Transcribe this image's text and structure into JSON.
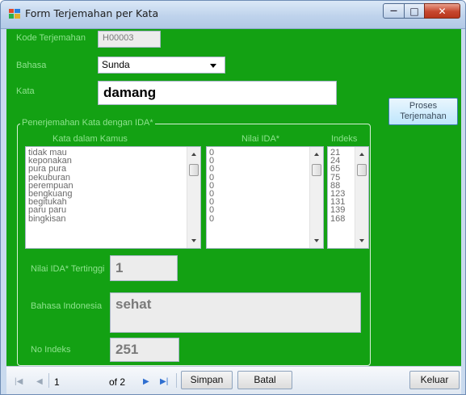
{
  "window": {
    "title": "Form Terjemahan per Kata",
    "minimize_glyph": "—",
    "maximize_glyph": "□",
    "close_glyph": "✕"
  },
  "colors": {
    "form_background": "#13a113",
    "label_text": "#8ee38e"
  },
  "form": {
    "kode_label": "Kode Terjemahan",
    "kode_value": "H00003",
    "bahasa_label": "Bahasa",
    "bahasa_value": "Sunda",
    "kata_label": "Kata",
    "kata_value": "damang",
    "proses_button_line1": "Proses",
    "proses_button_line2": "Terjemahan"
  },
  "group": {
    "title": "Penerjemahan Kata dengan IDA*",
    "col_kata_header": "Kata dalam Kamus",
    "col_nilai_header": "Nilai IDA*",
    "col_indeks_header": "Indeks",
    "kata_items": [
      "tidak mau",
      "keponakan",
      "pura pura",
      "pekuburan",
      "perempuan",
      "bengkuang",
      "begitukah",
      "paru paru",
      "bingkisan"
    ],
    "nilai_items": [
      "0",
      "0",
      "0",
      "0",
      "0",
      "0",
      "0",
      "0",
      "0"
    ],
    "indeks_items": [
      "21",
      "24",
      "65",
      "75",
      "88",
      "123",
      "131",
      "139",
      "168"
    ],
    "nilai_tertinggi_label": "Nilai IDA* Tertinggi",
    "nilai_tertinggi_value": "1",
    "bahasa_indonesia_label": "Bahasa Indonesia",
    "bahasa_indonesia_value": "sehat",
    "no_indeks_label": "No Indeks",
    "no_indeks_value": "251"
  },
  "navigator": {
    "first_glyph": "|◀",
    "prev_glyph": "◀",
    "position": "1",
    "of_text": "of 2",
    "next_glyph": "▶",
    "last_glyph": "▶|",
    "simpan_label": "Simpan",
    "batal_label": "Batal",
    "keluar_label": "Keluar"
  }
}
